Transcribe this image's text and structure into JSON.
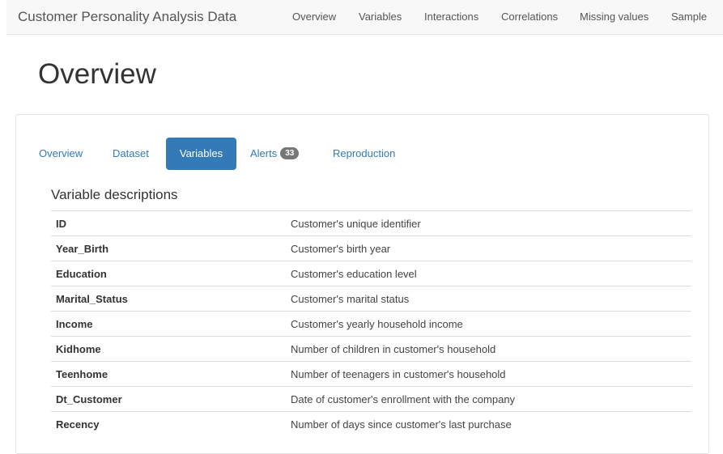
{
  "navbar": {
    "brand": "Customer Personality Analysis Data",
    "links": [
      "Overview",
      "Variables",
      "Interactions",
      "Correlations",
      "Missing values",
      "Sample"
    ]
  },
  "page_title": "Overview",
  "tabs": {
    "overview": "Overview",
    "dataset": "Dataset",
    "variables": "Variables",
    "alerts": "Alerts",
    "alerts_count": "33",
    "reproduction": "Reproduction",
    "active": "Variables"
  },
  "section": {
    "title": "Variable descriptions"
  },
  "variables": [
    {
      "name": "ID",
      "description": "Customer's unique identifier"
    },
    {
      "name": "Year_Birth",
      "description": "Customer's birth year"
    },
    {
      "name": "Education",
      "description": "Customer's education level"
    },
    {
      "name": "Marital_Status",
      "description": "Customer's marital status"
    },
    {
      "name": "Income",
      "description": "Customer's yearly household income"
    },
    {
      "name": "Kidhome",
      "description": "Number of children in customer's household"
    },
    {
      "name": "Teenhome",
      "description": "Number of teenagers in customer's household"
    },
    {
      "name": "Dt_Customer",
      "description": "Date of customer's enrollment with the company"
    },
    {
      "name": "Recency",
      "description": "Number of days since customer's last purchase"
    }
  ],
  "colors": {
    "accent": "#337ab7",
    "badge": "#777777",
    "navbar_bg": "#f8f8f8"
  }
}
